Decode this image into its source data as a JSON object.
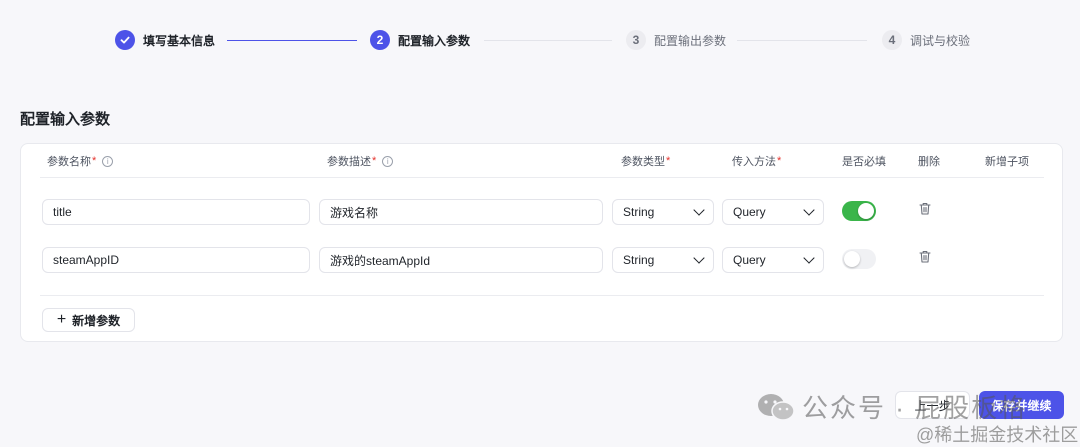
{
  "steps": [
    {
      "number": "",
      "label": "填写基本信息",
      "status": "done"
    },
    {
      "number": "2",
      "label": "配置输入参数",
      "status": "active"
    },
    {
      "number": "3",
      "label": "配置输出参数",
      "status": "todo"
    },
    {
      "number": "4",
      "label": "调试与校验",
      "status": "todo"
    }
  ],
  "section_title": "配置输入参数",
  "table": {
    "headers": {
      "name": "参数名称",
      "desc": "参数描述",
      "type": "参数类型",
      "method": "传入方法",
      "required": "是否必填",
      "delete": "删除",
      "add_child": "新增子项"
    },
    "required_mark": "*",
    "info_icon": "i",
    "rows": [
      {
        "name": "title",
        "desc": "游戏名称",
        "type": "String",
        "method": "Query",
        "required": true
      },
      {
        "name": "steamAppID",
        "desc": "游戏的steamAppId",
        "type": "String",
        "method": "Query",
        "required": false
      }
    ]
  },
  "add_param_label": "新增参数",
  "add_param_icon": "+",
  "footer": {
    "prev_label": "上一步",
    "save_label": "保存并继续"
  },
  "watermark": {
    "main": "公众号 · 屁股板格",
    "sub": "@稀土掘金技术社区"
  },
  "colors": {
    "accent": "#4d53e8",
    "toggle_on": "#3ab54a",
    "required": "#e5312b"
  }
}
